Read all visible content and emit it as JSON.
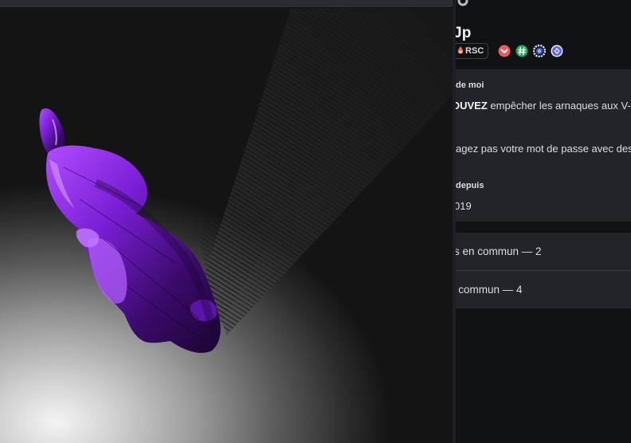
{
  "profile": {
    "username": "Jp",
    "guild_tag": "RSC",
    "badges": [
      {
        "name": "heart-chevron-badge",
        "color": "#f0575b"
      },
      {
        "name": "hashtag-badge",
        "color": "#23a55a"
      },
      {
        "name": "gear-badge",
        "color": "#8ea1e1"
      },
      {
        "name": "quest-badge",
        "color": "#5865f2"
      }
    ],
    "about": {
      "heading": "de moi",
      "bio_bold": "OUVEZ",
      "bio_rest": " empêcher les arnaques aux V-",
      "bio_line2": "agez pas votre mot de passe avec des"
    },
    "member_since": {
      "heading": "depuis",
      "value": "019"
    },
    "mutuals": [
      {
        "label": "s en commun — 2"
      },
      {
        "label": "n commun — 4"
      }
    ]
  },
  "colors": {
    "panel_bg": "#111214",
    "card_bg": "#232428",
    "text": "#dbdee1",
    "model_purple": "#7a1fd6"
  }
}
